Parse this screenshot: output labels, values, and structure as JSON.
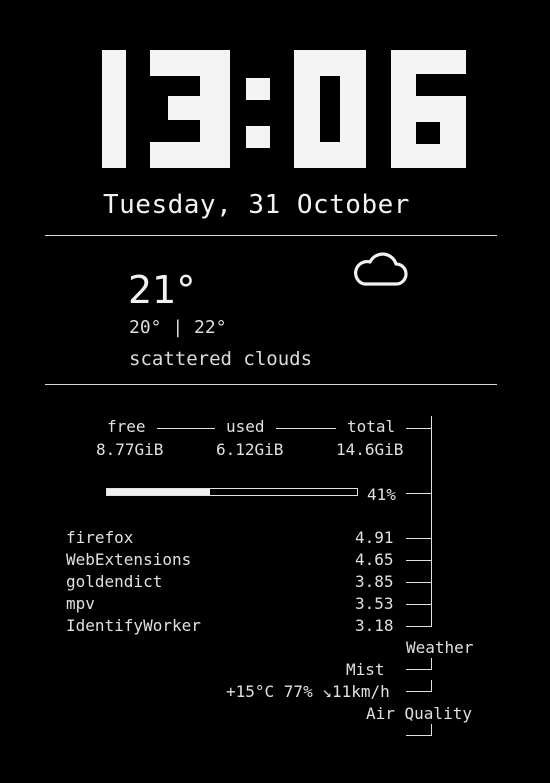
{
  "clock": {
    "time": "13:06"
  },
  "date": "Tuesday, 31 October",
  "weather_main": {
    "temperature": "21°",
    "range": "20° | 22°",
    "condition": "scattered clouds",
    "icon": "cloud-icon"
  },
  "memory": {
    "headers": {
      "free": "free",
      "used": "used",
      "total": "total"
    },
    "values": {
      "free": "8.77GiB",
      "used": "6.12GiB",
      "total": "14.6GiB"
    },
    "usage_percent_label": "41%",
    "usage_fraction": 0.41
  },
  "processes": [
    {
      "name": "firefox",
      "value": "4.91"
    },
    {
      "name": "WebExtensions",
      "value": "4.65"
    },
    {
      "name": "goldendict",
      "value": "3.85"
    },
    {
      "name": "mpv",
      "value": "3.53"
    },
    {
      "name": "IdentifyWorker",
      "value": "3.18"
    }
  ],
  "weather_widget": {
    "title": "Weather",
    "condition": "Mist",
    "details": "+15°C 77% ↘11km/h"
  },
  "air_quality": {
    "title": "Air Quality"
  },
  "colors": {
    "background": "#000000",
    "foreground": "#e8e8e8"
  }
}
